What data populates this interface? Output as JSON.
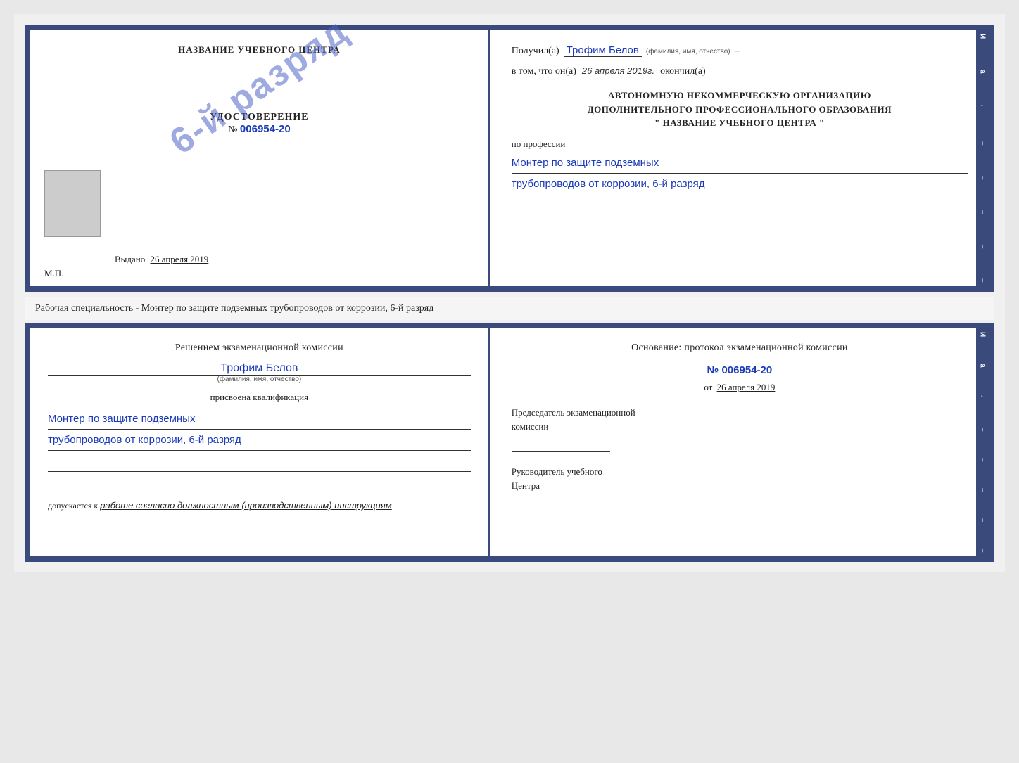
{
  "top_cert": {
    "left": {
      "org_title": "НАЗВАНИЕ УЧЕБНОГО ЦЕНТРА",
      "stamp_text": "6-й разряд",
      "udostoverenie": "УДОСТОВЕРЕНИЕ",
      "number_prefix": "№",
      "number": "006954-20",
      "vydano_prefix": "Выдано",
      "vydano_date": "26 апреля 2019",
      "mp": "М.П."
    },
    "right": {
      "poluchil_prefix": "Получил(а)",
      "fio": "Трофим Белов",
      "fio_sub": "(фамилия, имя, отчество)",
      "dash": "–",
      "vtom_prefix": "в том, что он(а)",
      "date": "26 апреля 2019г.",
      "okonchil": "окончил(а)",
      "org_line1": "АВТОНОМНУЮ НЕКОММЕРЧЕСКУЮ ОРГАНИЗАЦИЮ",
      "org_line2": "ДОПОЛНИТЕЛЬНОГО ПРОФЕССИОНАЛЬНОГО ОБРАЗОВАНИЯ",
      "org_line3": "\"  НАЗВАНИЕ УЧЕБНОГО ЦЕНТРА  \"",
      "po_professii": "по профессии",
      "profession_line1": "Монтер по защите подземных",
      "profession_line2": "трубопроводов от коррозии, 6-й разряд"
    }
  },
  "middle": {
    "text": "Рабочая специальность - Монтер по защите подземных трубопроводов от коррозии, 6-й разряд"
  },
  "bottom_cert": {
    "left": {
      "komissia_title": "Решением экзаменационной комиссии",
      "fio": "Трофим Белов",
      "fio_sub": "(фамилия, имя, отчество)",
      "prisvoena": "присвоена квалификация",
      "qualification_line1": "Монтер по защите подземных",
      "qualification_line2": "трубопроводов от коррозии, 6-й разряд",
      "dopuskaetsya_prefix": "допускается к",
      "dopuskaetsya_text": "работе согласно должностным (производственным) инструкциям"
    },
    "right": {
      "osnovanie_title": "Основание: протокол экзаменационной комиссии",
      "number_prefix": "№",
      "number": "006954-20",
      "date_prefix": "от",
      "date": "26 апреля 2019",
      "predsedatel_line1": "Председатель экзаменационной",
      "predsedatel_line2": "комиссии",
      "rukovoditel_line1": "Руководитель учебного",
      "rukovoditel_line2": "Центра"
    }
  },
  "side_letters": {
    "top_right": [
      "И",
      "а",
      "←",
      "–",
      "–",
      "–",
      "–",
      "–"
    ],
    "bottom_right": [
      "И",
      "а",
      "←",
      "–",
      "–",
      "–",
      "–",
      "–"
    ]
  }
}
